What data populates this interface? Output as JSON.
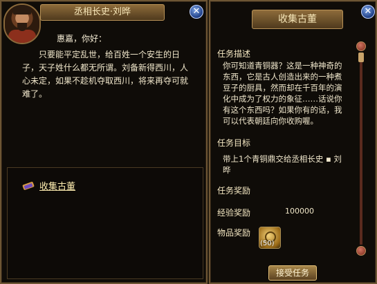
{
  "left_panel": {
    "title": "丞相长史·刘晔",
    "greeting": "惠嘉，你好：",
    "dialogue": "只要能平定乱世，给百姓一个安生的日子，天子姓什么都无所谓。刘备新得西川，人心未定，如果不趁机夺取西川，将来再夺可就难了。",
    "quest_link": "收集古董"
  },
  "right_panel": {
    "title": "收集古董",
    "desc_label": "任务描述",
    "desc_text": "你可知道青铜器？这是一种神奇的东西，它是古人创造出来的一种煮豆子的厨具，然而却在千百年的演化中成为了权力的象征……话说你有这个东西吗？如果你有的话，我可以代表朝廷向你收购喔。",
    "goal_label": "任务目标",
    "goal_text": "带上1个青铜鼎交给丞相长史 ▪ 刘晔",
    "reward_label": "任务奖励",
    "exp_label": "经验奖励",
    "exp_value": "100000",
    "item_label": "物品奖励",
    "item_count": "(50)",
    "accept_label": "接受任务"
  },
  "icons": {
    "close": "close-icon",
    "quest": "quest-scroll-icon",
    "coin": "coin-icon"
  },
  "colors": {
    "border_gold": "#6e5634",
    "title_text": "#f7e7b9",
    "close_blue": "#1f3f86",
    "scroll_red": "#7b2a1a"
  }
}
